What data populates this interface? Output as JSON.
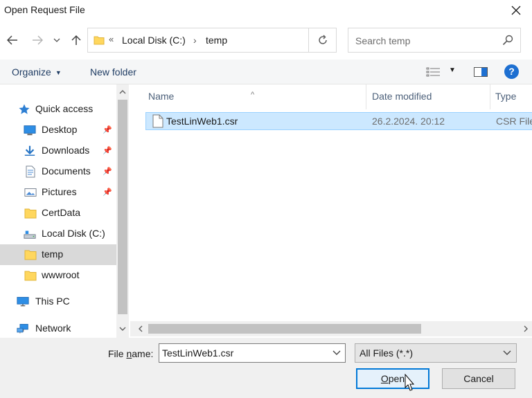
{
  "window": {
    "title": "Open Request File"
  },
  "address": {
    "root_chevron": "«",
    "parts": [
      "Local Disk (C:)",
      "temp"
    ],
    "separator": "›"
  },
  "search": {
    "placeholder": "Search temp"
  },
  "toolbar": {
    "organize": "Organize",
    "new_folder": "New folder",
    "help": "?"
  },
  "nav": {
    "items": [
      {
        "label": "Quick access",
        "icon": "star-icon"
      },
      {
        "label": "Desktop",
        "icon": "desktop-icon",
        "pinned": true
      },
      {
        "label": "Downloads",
        "icon": "download-icon",
        "pinned": true
      },
      {
        "label": "Documents",
        "icon": "document-icon",
        "pinned": true
      },
      {
        "label": "Pictures",
        "icon": "pictures-icon",
        "pinned": true
      },
      {
        "label": "CertData",
        "icon": "folder-icon"
      },
      {
        "label": "Local Disk (C:)",
        "icon": "drive-icon"
      },
      {
        "label": "temp",
        "icon": "folder-icon",
        "selected": true
      },
      {
        "label": "wwwroot",
        "icon": "folder-icon"
      },
      {
        "label": "This PC",
        "icon": "computer-icon"
      },
      {
        "label": "Network",
        "icon": "network-icon"
      }
    ]
  },
  "columns": {
    "name": "Name",
    "date": "Date modified",
    "type": "Type"
  },
  "files": [
    {
      "name": "TestLinWeb1.csr",
      "date": "26.2.2024. 20:12",
      "type": "CSR File"
    }
  ],
  "bottom": {
    "file_name_label_pre": "File ",
    "file_name_label_u": "n",
    "file_name_label_post": "ame:",
    "file_name_value": "TestLinWeb1.csr",
    "file_type": "All Files (*.*)",
    "open_u": "O",
    "open_rest": "pen",
    "cancel": "Cancel"
  },
  "colors": {
    "accent": "#0078d7",
    "selection": "#cce8ff",
    "folder": "#ffd75e",
    "help": "#1d6fd1"
  }
}
